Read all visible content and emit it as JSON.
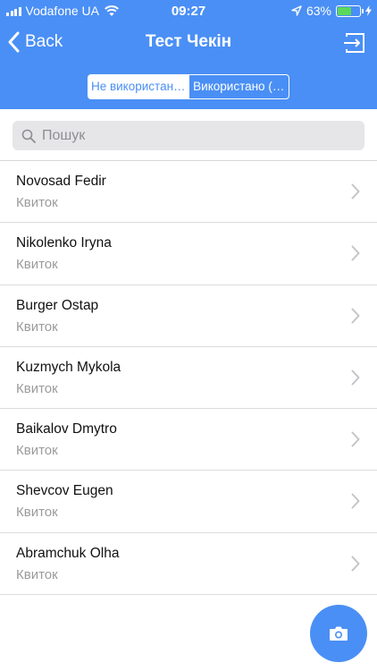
{
  "status_bar": {
    "carrier": "Vodafone UA",
    "time": "09:27",
    "battery": "63%",
    "battery_level": 0.63
  },
  "nav": {
    "back_label": "Back",
    "title": "Тест Чекін"
  },
  "segments": [
    {
      "label": "Не використан…",
      "selected": true
    },
    {
      "label": "Використано (…",
      "selected": false
    }
  ],
  "search": {
    "placeholder": "Пошук"
  },
  "attendees": [
    {
      "name": "Novosad Fedir",
      "type": "Квиток"
    },
    {
      "name": "Nikolenko Iryna",
      "type": "Квиток"
    },
    {
      "name": "Burger Ostap",
      "type": "Квиток"
    },
    {
      "name": "Kuzmych Mykola",
      "type": "Квиток"
    },
    {
      "name": "Baikalov Dmytro",
      "type": "Квиток"
    },
    {
      "name": "Shevcov Eugen",
      "type": "Квиток"
    },
    {
      "name": "Abramchuk Olha",
      "type": "Квиток"
    }
  ],
  "colors": {
    "accent": "#4a8ff5",
    "battery": "#5bd85b"
  },
  "icons": {
    "back": "chevron-left-icon",
    "logout": "logout-arrow-icon",
    "search": "search-icon",
    "row": "chevron-right-icon",
    "fab": "camera-icon"
  }
}
